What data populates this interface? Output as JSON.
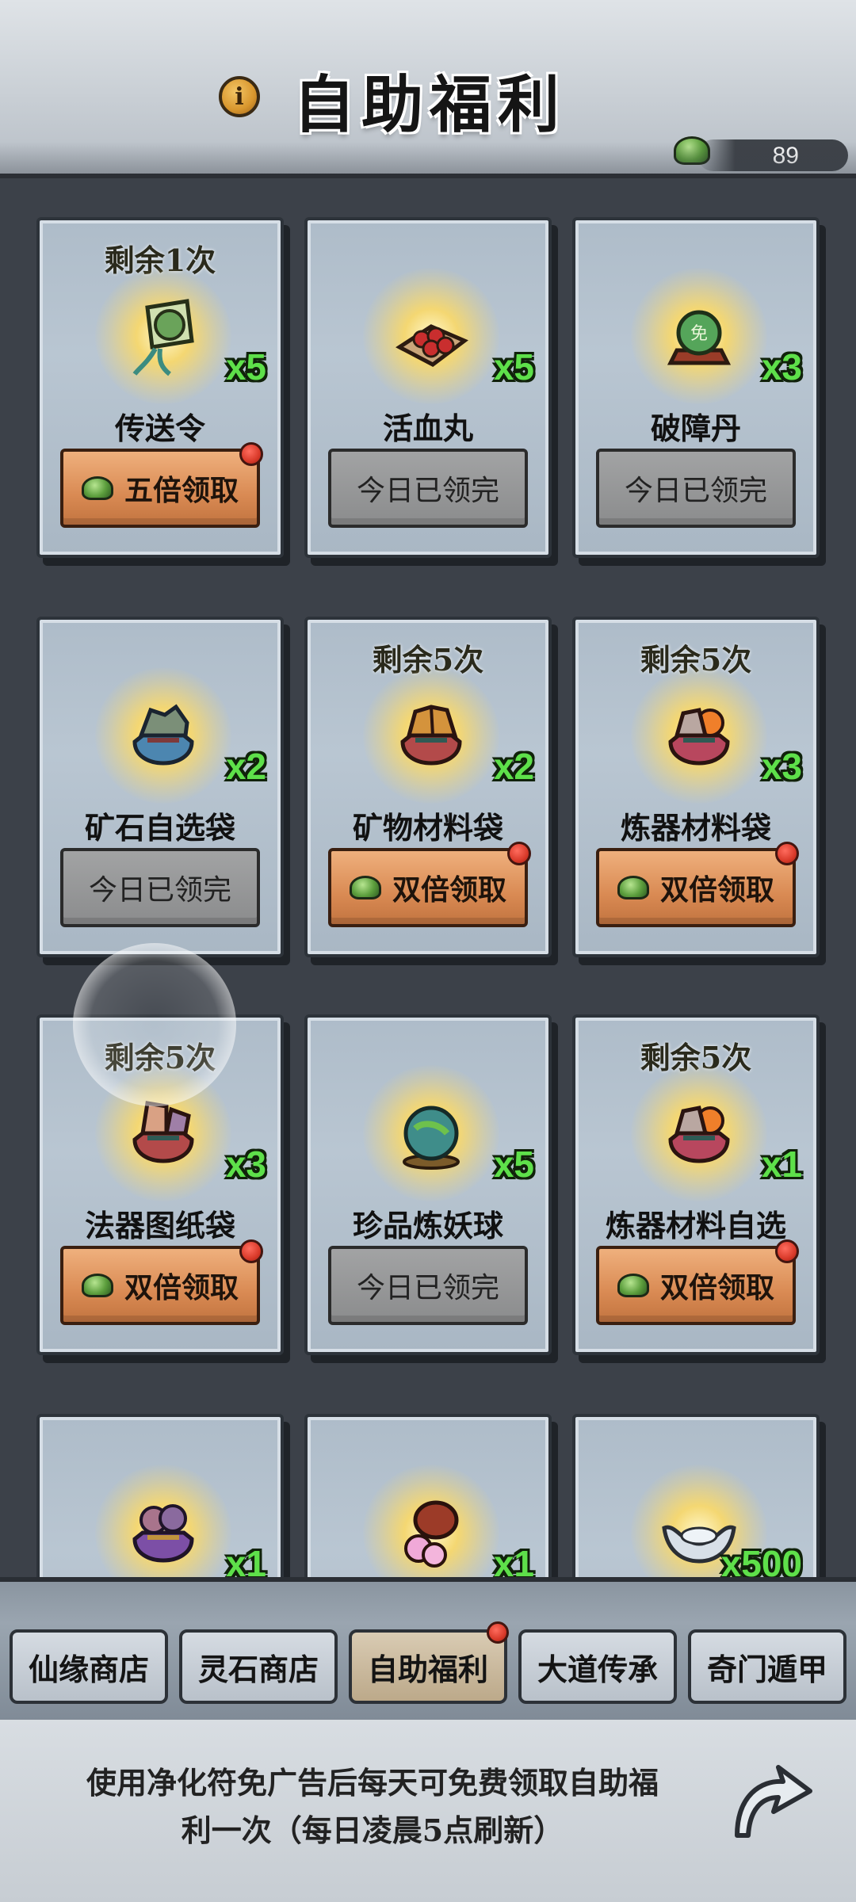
{
  "header": {
    "title": "自助福利",
    "info_icon": "i",
    "currency": {
      "icon": "jade-stone-icon",
      "value": "89"
    }
  },
  "rows_visible": 4,
  "cards": [
    {
      "remaining": "剩余1次",
      "name": "传送令",
      "qty": "x5",
      "button": "五倍领取",
      "state": "active",
      "icon": "teleport-token-icon"
    },
    {
      "remaining": "",
      "name": "活血丸",
      "qty": "x5",
      "button": "今日已领完",
      "state": "done",
      "icon": "blood-pill-icon"
    },
    {
      "remaining": "",
      "name": "破障丹",
      "qty": "x3",
      "button": "今日已领完",
      "state": "done",
      "icon": "breakthrough-pill-icon"
    },
    {
      "remaining": "",
      "name": "矿石自选袋",
      "qty": "x2",
      "button": "今日已领完",
      "state": "done",
      "icon": "ore-bag-icon"
    },
    {
      "remaining": "剩余5次",
      "name": "矿物材料袋",
      "qty": "x2",
      "button": "双倍领取",
      "state": "active",
      "icon": "mineral-bag-icon"
    },
    {
      "remaining": "剩余5次",
      "name": "炼器材料袋",
      "qty": "x3",
      "button": "双倍领取",
      "state": "active",
      "icon": "forge-bag-icon"
    },
    {
      "remaining": "剩余5次",
      "name": "法器图纸袋",
      "qty": "x3",
      "button": "双倍领取",
      "state": "active",
      "icon": "blueprint-bag-icon"
    },
    {
      "remaining": "",
      "name": "珍品炼妖球",
      "qty": "x5",
      "button": "今日已领完",
      "state": "done",
      "icon": "demon-orb-icon"
    },
    {
      "remaining": "剩余5次",
      "name": "炼器材料自选",
      "qty": "x1",
      "button": "双倍领取",
      "state": "active",
      "icon": "forge-select-bag-icon"
    },
    {
      "remaining": "",
      "name": "",
      "qty": "x1",
      "button": "",
      "state": "hidden",
      "icon": "purple-bag-icon"
    },
    {
      "remaining": "",
      "name": "",
      "qty": "x1",
      "button": "",
      "state": "hidden",
      "icon": "flower-pot-icon"
    },
    {
      "remaining": "",
      "name": "",
      "qty": "x500",
      "button": "",
      "state": "hidden",
      "icon": "silver-ingot-icon"
    }
  ],
  "tabs": [
    {
      "label": "仙缘商店",
      "selected": false,
      "dot": false
    },
    {
      "label": "灵石商店",
      "selected": false,
      "dot": false
    },
    {
      "label": "自助福利",
      "selected": true,
      "dot": true
    },
    {
      "label": "大道传承",
      "selected": false,
      "dot": false
    },
    {
      "label": "奇门遁甲",
      "selected": false,
      "dot": false
    }
  ],
  "footer": {
    "hint_line1": "使用净化符免广告后每天可免费领取自助福",
    "hint_line2": "利一次（每日凌晨5点刷新）",
    "return_icon": "return-arrow-icon"
  },
  "colors": {
    "active_button": "#d98a53",
    "done_button": "#8b8c8d",
    "qty_text": "#5ee04a",
    "red_dot": "#d93a2a"
  }
}
